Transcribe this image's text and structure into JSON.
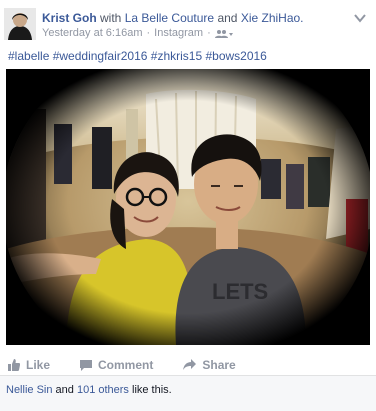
{
  "header": {
    "author": "Krist Goh",
    "with_word": "with",
    "tag1": "La Belle Couture",
    "and_word": "and",
    "tag2": "Xie ZhiHao.",
    "time": "Yesterday at 6:16am",
    "separator": "·",
    "via": "Instagram"
  },
  "caption": "#labelle #weddingfair2016 #zhkris15 #bows2016",
  "actions": {
    "like": "Like",
    "comment": "Comment",
    "share": "Share"
  },
  "likes": {
    "first_liker": "Nellie Sin",
    "and_word": "and",
    "others": "101 others",
    "suffix": "like this."
  },
  "icons": {
    "audience": "friends-icon",
    "options": "chevron-down-icon",
    "like": "thumbs-up-icon",
    "comment": "comment-icon",
    "share": "share-arrow-icon"
  },
  "colors": {
    "link": "#3b5998",
    "muted": "#9197a3",
    "text": "#141823",
    "bar": "#f6f7f9"
  }
}
